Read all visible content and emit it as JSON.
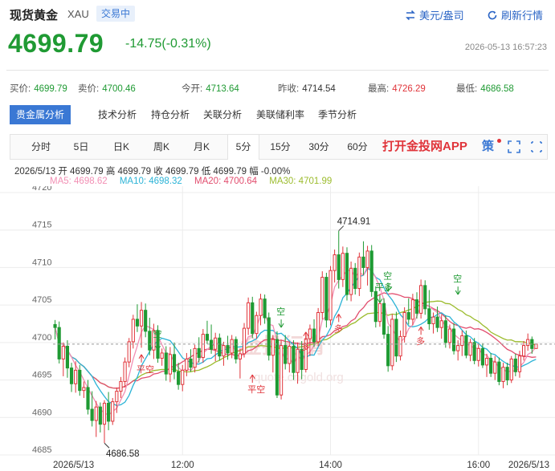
{
  "header": {
    "title": "现货黄金",
    "symbol": "XAU",
    "status": "交易中",
    "currency_link": "美元/盎司",
    "refresh_link": "刷新行情"
  },
  "quote": {
    "price": "4699.79",
    "change": "-14.75(-0.31%)",
    "datetime": "2026-05-13 16:57:23"
  },
  "stats": [
    {
      "label": "买价:",
      "value": "4699.79",
      "color": "green"
    },
    {
      "label": "卖价:",
      "value": "4700.46",
      "color": "green"
    },
    {
      "label": "今开:",
      "value": "4713.64",
      "color": "green"
    },
    {
      "label": "昨收:",
      "value": "4714.54",
      "color": "plain"
    },
    {
      "label": "最高:",
      "value": "4726.29",
      "color": "red"
    },
    {
      "label": "最低:",
      "value": "4686.58",
      "color": "green"
    }
  ],
  "tabs": [
    {
      "label": "贵金属分析",
      "active": true
    },
    {
      "label": "技术分析",
      "active": false
    },
    {
      "label": "持仓分析",
      "active": false
    },
    {
      "label": "关联分析",
      "active": false
    },
    {
      "label": "美联储利率",
      "active": false
    },
    {
      "label": "季节分析",
      "active": false
    }
  ],
  "periods": [
    {
      "label": "分时",
      "active": false
    },
    {
      "label": "5日",
      "active": false
    },
    {
      "label": "日K",
      "active": false
    },
    {
      "label": "周K",
      "active": false
    },
    {
      "label": "月K",
      "active": false
    },
    {
      "label": "5分",
      "active": true
    },
    {
      "label": "15分",
      "active": false
    },
    {
      "label": "30分",
      "active": false
    },
    {
      "label": "60分",
      "active": false
    }
  ],
  "app_link": "打开金投网APP",
  "strategy_label": "策",
  "ohlc_line": "2026/5/13  开 4699.79  高 4699.79  收 4699.79  低 4699.79  幅 -0.00%",
  "ma_legend": [
    {
      "label": "MA5: 4698.62",
      "color": "#f28fb4"
    },
    {
      "label": "MA10: 4698.32",
      "color": "#2bb3d6"
    },
    {
      "label": "MA20: 4700.64",
      "color": "#e24d6e"
    },
    {
      "label": "MA30: 4701.99",
      "color": "#9cbc2e"
    }
  ],
  "watermark": {
    "text": "金投行情",
    "url": "quote.cngold.org"
  },
  "colors": {
    "up": "#e0343a",
    "down": "#1f9a33",
    "accent": "#3a78d4"
  },
  "chart_data": {
    "type": "candlestick",
    "y_ticks": [
      4685,
      4690,
      4695,
      4700,
      4705,
      4710,
      4715,
      4720
    ],
    "ylim": [
      4685,
      4720
    ],
    "x_tick_labels": [
      {
        "bar": 0,
        "label": "2026/5/13"
      },
      {
        "bar": 31,
        "label": "12:00"
      },
      {
        "bar": 67,
        "label": "14:00"
      },
      {
        "bar": 103,
        "label": "16:00"
      },
      {
        "bar": 119,
        "label": "2026/5/13"
      }
    ],
    "annotations": [
      {
        "bar": 69,
        "price": 4714.91,
        "label": "4714.91"
      },
      {
        "bar": 12,
        "price": 4686.58,
        "label": "4686.58"
      }
    ],
    "signals": [
      {
        "bar": 21,
        "price": 4698.4,
        "label": "平空",
        "dir": "up"
      },
      {
        "bar": 25,
        "price": 4699.0,
        "label": "空",
        "dir": "down"
      },
      {
        "bar": 48,
        "price": 4695.7,
        "label": "平空",
        "dir": "up"
      },
      {
        "bar": 55,
        "price": 4702.0,
        "label": "空",
        "dir": "down"
      },
      {
        "bar": 61,
        "price": 4701.4,
        "label": "多",
        "dir": "up"
      },
      {
        "bar": 69,
        "price": 4703.8,
        "label": "多",
        "dir": "up"
      },
      {
        "bar": 81,
        "price": 4706.8,
        "label": "空",
        "dir": "down"
      },
      {
        "bar": 79,
        "price": 4705.3,
        "label": "平多",
        "dir": "down"
      },
      {
        "bar": 89,
        "price": 4702.1,
        "label": "多",
        "dir": "up"
      },
      {
        "bar": 98,
        "price": 4706.4,
        "label": "空",
        "dir": "down"
      }
    ],
    "candles": [
      {
        "o": 4702.4,
        "h": 4703.0,
        "l": 4700.4,
        "c": 4702.0
      },
      {
        "o": 4702.0,
        "h": 4702.8,
        "l": 4697.2,
        "c": 4697.8
      },
      {
        "o": 4697.8,
        "h": 4700.0,
        "l": 4695.5,
        "c": 4699.5
      },
      {
        "o": 4699.5,
        "h": 4700.3,
        "l": 4695.3,
        "c": 4696.6
      },
      {
        "o": 4696.6,
        "h": 4697.3,
        "l": 4693.4,
        "c": 4694.5
      },
      {
        "o": 4694.5,
        "h": 4697.5,
        "l": 4693.3,
        "c": 4696.3
      },
      {
        "o": 4696.3,
        "h": 4697.0,
        "l": 4692.9,
        "c": 4693.6
      },
      {
        "o": 4693.6,
        "h": 4694.8,
        "l": 4692.6,
        "c": 4694.0
      },
      {
        "o": 4694.0,
        "h": 4695.0,
        "l": 4690.4,
        "c": 4691.1
      },
      {
        "o": 4691.1,
        "h": 4693.5,
        "l": 4688.8,
        "c": 4689.6
      },
      {
        "o": 4689.6,
        "h": 4692.2,
        "l": 4687.4,
        "c": 4691.4
      },
      {
        "o": 4691.4,
        "h": 4692.0,
        "l": 4688.0,
        "c": 4689.1
      },
      {
        "o": 4689.1,
        "h": 4692.3,
        "l": 4686.6,
        "c": 4691.9
      },
      {
        "o": 4691.9,
        "h": 4693.4,
        "l": 4688.3,
        "c": 4689.5
      },
      {
        "o": 4689.5,
        "h": 4692.6,
        "l": 4689.0,
        "c": 4692.1
      },
      {
        "o": 4692.1,
        "h": 4694.0,
        "l": 4690.6,
        "c": 4693.5
      },
      {
        "o": 4693.5,
        "h": 4695.4,
        "l": 4692.6,
        "c": 4694.8
      },
      {
        "o": 4694.8,
        "h": 4698.0,
        "l": 4694.0,
        "c": 4697.4
      },
      {
        "o": 4697.4,
        "h": 4700.6,
        "l": 4696.7,
        "c": 4700.1
      },
      {
        "o": 4700.1,
        "h": 4703.7,
        "l": 4699.2,
        "c": 4703.1
      },
      {
        "o": 4703.1,
        "h": 4705.1,
        "l": 4701.4,
        "c": 4702.2
      },
      {
        "o": 4702.2,
        "h": 4705.4,
        "l": 4699.3,
        "c": 4704.3
      },
      {
        "o": 4704.3,
        "h": 4705.2,
        "l": 4700.7,
        "c": 4701.5
      },
      {
        "o": 4701.5,
        "h": 4703.3,
        "l": 4698.3,
        "c": 4699.0
      },
      {
        "o": 4699.0,
        "h": 4702.5,
        "l": 4697.8,
        "c": 4701.6
      },
      {
        "o": 4701.6,
        "h": 4702.3,
        "l": 4697.3,
        "c": 4697.9
      },
      {
        "o": 4697.9,
        "h": 4699.2,
        "l": 4696.9,
        "c": 4698.6
      },
      {
        "o": 4698.6,
        "h": 4699.5,
        "l": 4694.9,
        "c": 4695.8
      },
      {
        "o": 4695.8,
        "h": 4699.4,
        "l": 4694.7,
        "c": 4698.4
      },
      {
        "o": 4698.4,
        "h": 4700.0,
        "l": 4695.1,
        "c": 4696.1
      },
      {
        "o": 4696.1,
        "h": 4697.3,
        "l": 4693.7,
        "c": 4694.4
      },
      {
        "o": 4694.4,
        "h": 4697.0,
        "l": 4693.5,
        "c": 4696.3
      },
      {
        "o": 4696.3,
        "h": 4698.6,
        "l": 4695.5,
        "c": 4697.8
      },
      {
        "o": 4697.8,
        "h": 4699.1,
        "l": 4696.1,
        "c": 4696.7
      },
      {
        "o": 4696.7,
        "h": 4699.7,
        "l": 4696.0,
        "c": 4699.2
      },
      {
        "o": 4699.2,
        "h": 4700.7,
        "l": 4697.3,
        "c": 4698.0
      },
      {
        "o": 4698.0,
        "h": 4701.8,
        "l": 4697.3,
        "c": 4701.1
      },
      {
        "o": 4701.1,
        "h": 4702.9,
        "l": 4699.8,
        "c": 4700.3
      },
      {
        "o": 4700.3,
        "h": 4702.4,
        "l": 4698.5,
        "c": 4699.1
      },
      {
        "o": 4699.1,
        "h": 4701.3,
        "l": 4697.5,
        "c": 4700.6
      },
      {
        "o": 4700.6,
        "h": 4701.2,
        "l": 4697.6,
        "c": 4698.2
      },
      {
        "o": 4698.2,
        "h": 4700.1,
        "l": 4696.9,
        "c": 4699.6
      },
      {
        "o": 4699.6,
        "h": 4700.9,
        "l": 4697.7,
        "c": 4698.6
      },
      {
        "o": 4698.6,
        "h": 4701.0,
        "l": 4697.9,
        "c": 4700.4
      },
      {
        "o": 4700.4,
        "h": 4700.8,
        "l": 4697.2,
        "c": 4697.8
      },
      {
        "o": 4697.8,
        "h": 4699.2,
        "l": 4695.2,
        "c": 4698.5
      },
      {
        "o": 4698.5,
        "h": 4702.6,
        "l": 4698.0,
        "c": 4701.9
      },
      {
        "o": 4701.9,
        "h": 4706.0,
        "l": 4701.0,
        "c": 4705.3
      },
      {
        "o": 4705.3,
        "h": 4706.1,
        "l": 4700.6,
        "c": 4701.2
      },
      {
        "o": 4701.2,
        "h": 4704.1,
        "l": 4700.5,
        "c": 4703.6
      },
      {
        "o": 4703.6,
        "h": 4706.5,
        "l": 4702.3,
        "c": 4705.8
      },
      {
        "o": 4705.8,
        "h": 4706.4,
        "l": 4702.5,
        "c": 4703.3
      },
      {
        "o": 4703.3,
        "h": 4704.0,
        "l": 4697.6,
        "c": 4698.3
      },
      {
        "o": 4698.3,
        "h": 4701.0,
        "l": 4696.0,
        "c": 4700.4
      },
      {
        "o": 4700.4,
        "h": 4701.5,
        "l": 4692.6,
        "c": 4693.0
      },
      {
        "o": 4693.0,
        "h": 4700.3,
        "l": 4692.4,
        "c": 4699.6
      },
      {
        "o": 4699.6,
        "h": 4701.0,
        "l": 4696.4,
        "c": 4697.2
      },
      {
        "o": 4697.2,
        "h": 4700.1,
        "l": 4696.0,
        "c": 4699.5
      },
      {
        "o": 4699.5,
        "h": 4700.3,
        "l": 4695.0,
        "c": 4696.0
      },
      {
        "o": 4696.0,
        "h": 4700.0,
        "l": 4694.5,
        "c": 4699.1
      },
      {
        "o": 4699.1,
        "h": 4700.2,
        "l": 4695.1,
        "c": 4696.4
      },
      {
        "o": 4696.4,
        "h": 4701.1,
        "l": 4696.0,
        "c": 4700.5
      },
      {
        "o": 4700.5,
        "h": 4702.4,
        "l": 4698.2,
        "c": 4701.8
      },
      {
        "o": 4701.8,
        "h": 4703.1,
        "l": 4699.4,
        "c": 4700.1
      },
      {
        "o": 4700.1,
        "h": 4704.6,
        "l": 4699.5,
        "c": 4704.0
      },
      {
        "o": 4704.0,
        "h": 4709.5,
        "l": 4703.1,
        "c": 4708.7
      },
      {
        "o": 4708.7,
        "h": 4709.3,
        "l": 4702.0,
        "c": 4703.0
      },
      {
        "o": 4703.0,
        "h": 4710.2,
        "l": 4702.3,
        "c": 4709.6
      },
      {
        "o": 4709.6,
        "h": 4712.4,
        "l": 4708.0,
        "c": 4711.7
      },
      {
        "o": 4711.7,
        "h": 4714.9,
        "l": 4707.2,
        "c": 4708.4
      },
      {
        "o": 4708.4,
        "h": 4712.8,
        "l": 4707.4,
        "c": 4711.9
      },
      {
        "o": 4711.9,
        "h": 4712.7,
        "l": 4705.6,
        "c": 4706.4
      },
      {
        "o": 4706.4,
        "h": 4710.8,
        "l": 4705.5,
        "c": 4709.9
      },
      {
        "o": 4709.9,
        "h": 4710.6,
        "l": 4706.4,
        "c": 4707.2
      },
      {
        "o": 4707.2,
        "h": 4712.0,
        "l": 4706.2,
        "c": 4711.4
      },
      {
        "o": 4711.4,
        "h": 4713.5,
        "l": 4709.0,
        "c": 4710.0
      },
      {
        "o": 4710.0,
        "h": 4712.9,
        "l": 4707.6,
        "c": 4712.2
      },
      {
        "o": 4712.2,
        "h": 4713.0,
        "l": 4706.1,
        "c": 4706.8
      },
      {
        "o": 4706.8,
        "h": 4707.5,
        "l": 4702.0,
        "c": 4702.8
      },
      {
        "o": 4702.8,
        "h": 4706.0,
        "l": 4702.1,
        "c": 4705.2
      },
      {
        "o": 4705.2,
        "h": 4705.9,
        "l": 4700.5,
        "c": 4701.1
      },
      {
        "o": 4701.1,
        "h": 4702.2,
        "l": 4696.1,
        "c": 4696.9
      },
      {
        "o": 4696.9,
        "h": 4703.8,
        "l": 4696.3,
        "c": 4703.1
      },
      {
        "o": 4703.1,
        "h": 4704.1,
        "l": 4697.4,
        "c": 4698.2
      },
      {
        "o": 4698.2,
        "h": 4701.6,
        "l": 4697.6,
        "c": 4700.8
      },
      {
        "o": 4700.8,
        "h": 4704.7,
        "l": 4700.0,
        "c": 4704.0
      },
      {
        "o": 4704.0,
        "h": 4705.9,
        "l": 4702.4,
        "c": 4703.1
      },
      {
        "o": 4703.1,
        "h": 4706.5,
        "l": 4702.3,
        "c": 4705.7
      },
      {
        "o": 4705.7,
        "h": 4706.7,
        "l": 4703.2,
        "c": 4703.9
      },
      {
        "o": 4703.9,
        "h": 4708.4,
        "l": 4703.2,
        "c": 4707.6
      },
      {
        "o": 4707.6,
        "h": 4708.3,
        "l": 4703.7,
        "c": 4704.5
      },
      {
        "o": 4704.5,
        "h": 4707.0,
        "l": 4701.7,
        "c": 4702.5
      },
      {
        "o": 4702.5,
        "h": 4704.0,
        "l": 4701.2,
        "c": 4703.4
      },
      {
        "o": 4703.4,
        "h": 4704.8,
        "l": 4701.4,
        "c": 4702.0
      },
      {
        "o": 4702.0,
        "h": 4703.7,
        "l": 4700.5,
        "c": 4702.9
      },
      {
        "o": 4702.9,
        "h": 4703.6,
        "l": 4699.3,
        "c": 4700.0
      },
      {
        "o": 4700.0,
        "h": 4702.4,
        "l": 4699.2,
        "c": 4701.8
      },
      {
        "o": 4701.8,
        "h": 4702.6,
        "l": 4698.4,
        "c": 4698.9
      },
      {
        "o": 4698.9,
        "h": 4700.3,
        "l": 4697.6,
        "c": 4699.6
      },
      {
        "o": 4699.6,
        "h": 4701.6,
        "l": 4698.2,
        "c": 4700.9
      },
      {
        "o": 4700.9,
        "h": 4701.6,
        "l": 4697.9,
        "c": 4698.3
      },
      {
        "o": 4698.3,
        "h": 4700.5,
        "l": 4697.5,
        "c": 4700.0
      },
      {
        "o": 4700.0,
        "h": 4700.6,
        "l": 4697.1,
        "c": 4697.6
      },
      {
        "o": 4697.6,
        "h": 4699.8,
        "l": 4696.8,
        "c": 4699.2
      },
      {
        "o": 4699.2,
        "h": 4699.9,
        "l": 4696.6,
        "c": 4697.0
      },
      {
        "o": 4697.0,
        "h": 4698.5,
        "l": 4695.4,
        "c": 4697.9
      },
      {
        "o": 4697.9,
        "h": 4698.6,
        "l": 4695.4,
        "c": 4695.9
      },
      {
        "o": 4695.9,
        "h": 4698.2,
        "l": 4695.0,
        "c": 4697.4
      },
      {
        "o": 4697.4,
        "h": 4698.0,
        "l": 4694.3,
        "c": 4694.8
      },
      {
        "o": 4694.8,
        "h": 4697.3,
        "l": 4693.9,
        "c": 4696.7
      },
      {
        "o": 4696.7,
        "h": 4697.3,
        "l": 4694.3,
        "c": 4695.0
      },
      {
        "o": 4695.0,
        "h": 4698.2,
        "l": 4694.6,
        "c": 4697.8
      },
      {
        "o": 4697.8,
        "h": 4698.5,
        "l": 4695.5,
        "c": 4696.1
      },
      {
        "o": 4696.1,
        "h": 4698.9,
        "l": 4695.3,
        "c": 4698.2
      },
      {
        "o": 4698.2,
        "h": 4700.2,
        "l": 4697.6,
        "c": 4699.6
      },
      {
        "o": 4699.6,
        "h": 4701.2,
        "l": 4698.9,
        "c": 4700.4
      },
      {
        "o": 4700.4,
        "h": 4700.8,
        "l": 4698.5,
        "c": 4699.2
      },
      {
        "o": 4699.2,
        "h": 4699.8,
        "l": 4699.2,
        "c": 4699.79
      }
    ]
  }
}
